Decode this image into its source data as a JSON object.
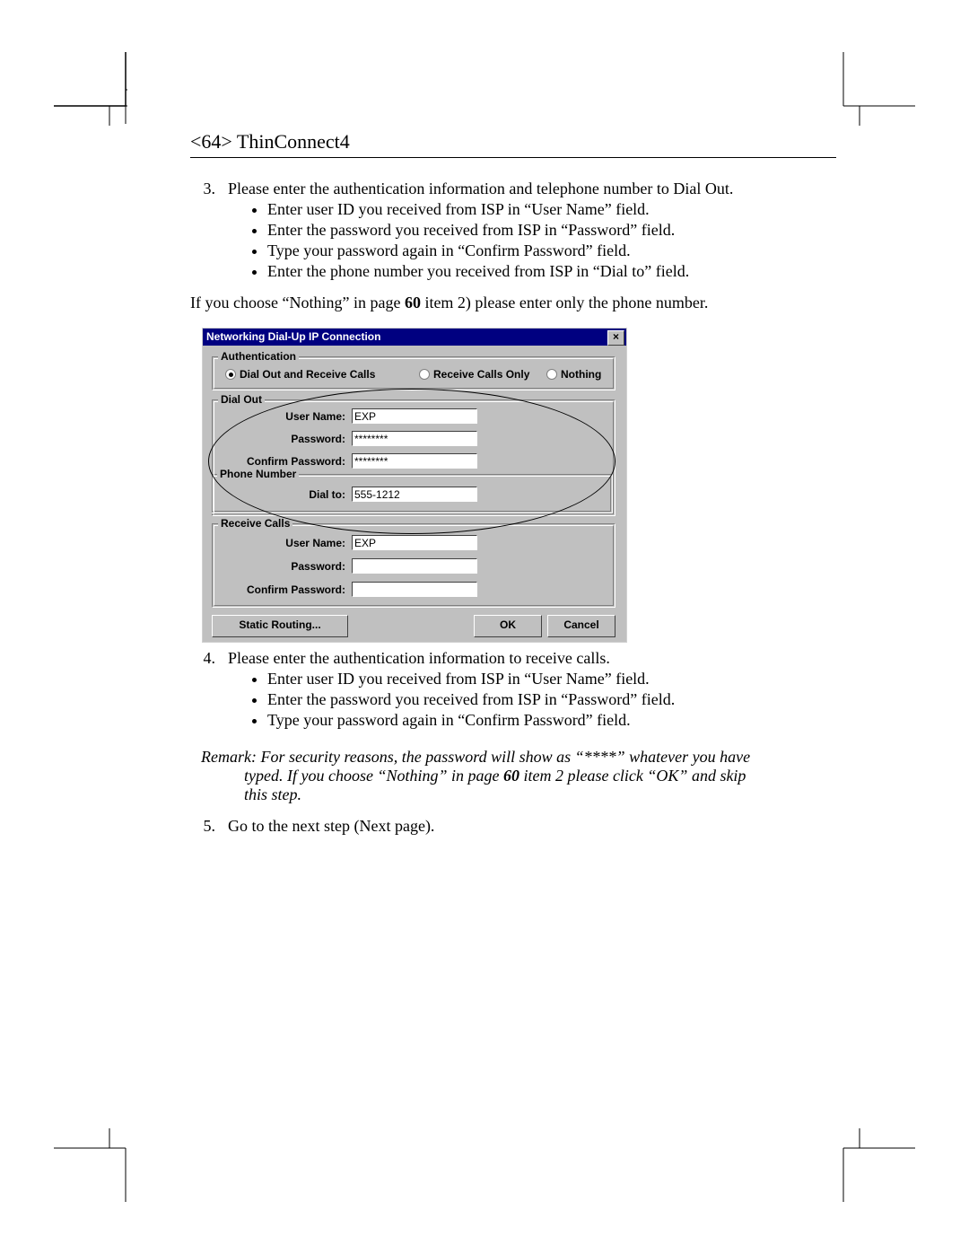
{
  "header": "<64> ThinConnect4",
  "step3": {
    "num": "3.",
    "lead": "Please enter the authentication information and telephone number to Dial Out.",
    "bullets": [
      "Enter user ID you received from ISP in “User Name” field.",
      "Enter the password you received from ISP in “Password” field.",
      "Type your password again in “Confirm Password” field.",
      "Enter the phone number you received from ISP in “Dial to” field."
    ]
  },
  "nothing_note_pre": "If you choose “Nothing” in page ",
  "nothing_note_bold": "60",
  "nothing_note_post": " item 2) please enter only the phone number.",
  "dialog": {
    "title": "Networking Dial-Up IP Connection",
    "close": "×",
    "auth": {
      "legend": "Authentication",
      "opt_both": "Dial Out and Receive Calls",
      "opt_recv": "Receive Calls Only",
      "opt_none": "Nothing"
    },
    "dialout": {
      "legend": "Dial Out",
      "user_label": "User Name:",
      "user_value": "EXP",
      "pass_label": "Password:",
      "pass_value": "********",
      "cpass_label": "Confirm Password:",
      "cpass_value": "********",
      "phone_legend": "Phone Number",
      "dial_label": "Dial to:",
      "dial_value": "555-1212"
    },
    "recv": {
      "legend": "Receive Calls",
      "user_label": "User Name:",
      "user_value": "EXP",
      "pass_label": "Password:",
      "cpass_label": "Confirm Password:"
    },
    "buttons": {
      "static": "Static Routing...",
      "ok": "OK",
      "cancel": "Cancel"
    }
  },
  "step4": {
    "num": "4.",
    "lead": "Please enter the authentication information to receive calls.",
    "bullets": [
      "Enter user ID you received from ISP in “User Name” field.",
      "Enter the password you received from ISP in “Password” field.",
      "Type your password again in “Confirm Password” field."
    ]
  },
  "remark_pre": "Remark: For security reasons, the password will show as “****” whatever you have",
  "remark_mid1": "typed. If you choose “Nothing” in page ",
  "remark_bold": "60",
  "remark_mid2": " item 2 please click “OK” and skip",
  "remark_end": "this step.",
  "step5": {
    "num": "5.",
    "text": "Go to the next step (Next page)."
  }
}
